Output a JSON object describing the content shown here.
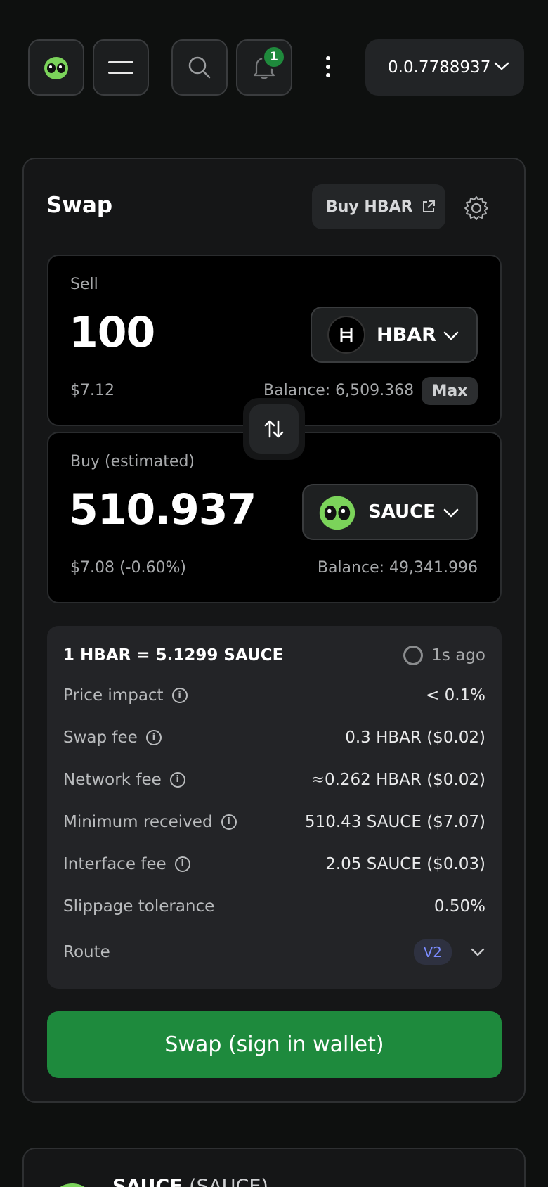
{
  "header": {
    "notification_count": "1",
    "account_id": "0.0.7788937"
  },
  "swap": {
    "title": "Swap",
    "buy_hbar_label": "Buy HBAR",
    "sell": {
      "label": "Sell",
      "amount": "100",
      "usd": "$7.12",
      "token": "HBAR",
      "balance": "Balance: 6,509.368",
      "max_label": "Max"
    },
    "buy": {
      "label": "Buy (estimated)",
      "amount": "510.937",
      "usd": "$7.08",
      "usd_change": "(-0.60%)",
      "token": "SAUCE",
      "balance": "Balance: 49,341.996"
    },
    "details": {
      "rate": "1 HBAR = 5.1299 SAUCE",
      "updated": "1s ago",
      "rows": [
        {
          "label": "Price impact",
          "value": "< 0.1%"
        },
        {
          "label": "Swap fee",
          "value": "0.3 HBAR ($0.02)"
        },
        {
          "label": "Network fee",
          "value": "≈0.262 HBAR ($0.02)"
        },
        {
          "label": "Minimum received",
          "value": "510.43 SAUCE ($7.07)"
        },
        {
          "label": "Interface fee",
          "value": "2.05 SAUCE ($0.03)"
        },
        {
          "label": "Slippage tolerance",
          "value": "0.50%"
        }
      ],
      "route_label": "Route",
      "route_version": "V2"
    },
    "submit_label": "Swap (sign in wallet)"
  },
  "token_info": {
    "title": "SAUCE",
    "subtitle": "(SAUCE)"
  },
  "colors": {
    "background": "#0e100f",
    "accent_green": "#1e8a3d",
    "route_badge": "#7b8cff"
  }
}
